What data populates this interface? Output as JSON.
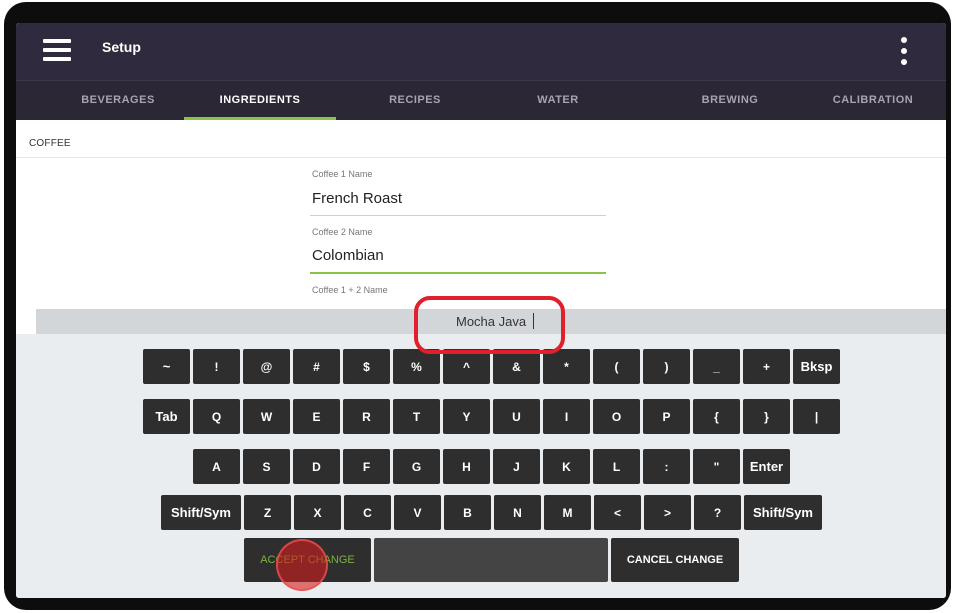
{
  "header": {
    "title": "Setup",
    "menu_icon": "hamburger-menu-icon",
    "more_icon": "more-vertical-icon"
  },
  "tabs": [
    {
      "label": "BEVERAGES",
      "active": false
    },
    {
      "label": "INGREDIENTS",
      "active": true
    },
    {
      "label": "RECIPES",
      "active": false
    },
    {
      "label": "WATER",
      "active": false
    },
    {
      "label": "BREWING",
      "active": false
    },
    {
      "label": "CALIBRATION",
      "active": false
    }
  ],
  "section": {
    "label": "COFFEE"
  },
  "fields": [
    {
      "label": "Coffee 1 Name",
      "value": "French Roast"
    },
    {
      "label": "Coffee 2 Name",
      "value": "Colombian"
    },
    {
      "label": "Coffee 1 + 2 Name",
      "value": ""
    }
  ],
  "keyboard": {
    "input_value": "Mocha Java",
    "rows": [
      [
        "~",
        "!",
        "@",
        "#",
        "$",
        "%",
        "^",
        "&",
        "*",
        "(",
        ")",
        "_",
        "+",
        "Bksp"
      ],
      [
        "Tab",
        "Q",
        "W",
        "E",
        "R",
        "T",
        "Y",
        "U",
        "I",
        "O",
        "P",
        "{",
        "}",
        "|"
      ],
      [
        "A",
        "S",
        "D",
        "F",
        "G",
        "H",
        "J",
        "K",
        "L",
        ":",
        "\"",
        "Enter"
      ],
      [
        "Shift/Sym",
        "Z",
        "X",
        "C",
        "V",
        "B",
        "N",
        "M",
        "<",
        ">",
        "?",
        "Shift/Sym"
      ]
    ],
    "accept_label": "ACCEPT CHANGE",
    "cancel_label": "CANCEL CHANGE"
  },
  "colors": {
    "appbar": "#2f2a3d",
    "accent": "#8bc34a",
    "highlight": "#e0202a"
  }
}
